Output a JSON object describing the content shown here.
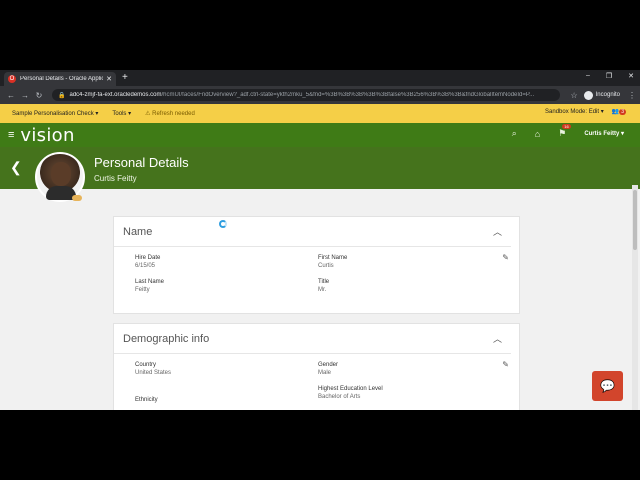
{
  "browser": {
    "tab_title": "Personal Details - Oracle Applica",
    "tab_favicon": "oracle-favicon-icon",
    "url_host": "adc4-zmjf-fa-ext.oracledemos.com",
    "url_path": "/hcmUI/faces/FndOverview?_adf.ctrl-state=ykth2mku_5&fnd=%3B%3B%3B%3B%3Bfalse%3B256%3B%3B%3B&fndGlobalItemNodeId=P...",
    "incognito_label": "Incognito"
  },
  "sandbox_bar": {
    "personalisation": "Sample Personalisation Check ▾",
    "tools": "Tools ▾",
    "refresh": "Refresh needed",
    "mode": "Sandbox Mode: Edit ▾",
    "badge": "3"
  },
  "header": {
    "logo": "vision",
    "notif_count": "16",
    "user": "Curtis Feitty ▾"
  },
  "title_band": {
    "title": "Personal Details",
    "name": "Curtis Feitty"
  },
  "name_card": {
    "title": "Name",
    "fields": [
      {
        "label": "Hire Date",
        "value": "6/15/05"
      },
      {
        "label": "First Name",
        "value": "Curtis"
      },
      {
        "label": "Last Name",
        "value": "Feitty"
      },
      {
        "label": "Title",
        "value": "Mr."
      }
    ]
  },
  "demo_card": {
    "title": "Demographic info",
    "fields": [
      {
        "label": "Country",
        "value": "United States"
      },
      {
        "label": "Gender",
        "value": "Male"
      },
      {
        "label": "Highest Education Level",
        "value": "Bachelor of Arts"
      },
      {
        "label": "Ethnicity",
        "value": ""
      }
    ]
  },
  "colors": {
    "header_green": "#3f7b16",
    "band_green": "#45731c",
    "sandbox_yellow": "#f5cf47",
    "chat_red": "#d2452c"
  }
}
